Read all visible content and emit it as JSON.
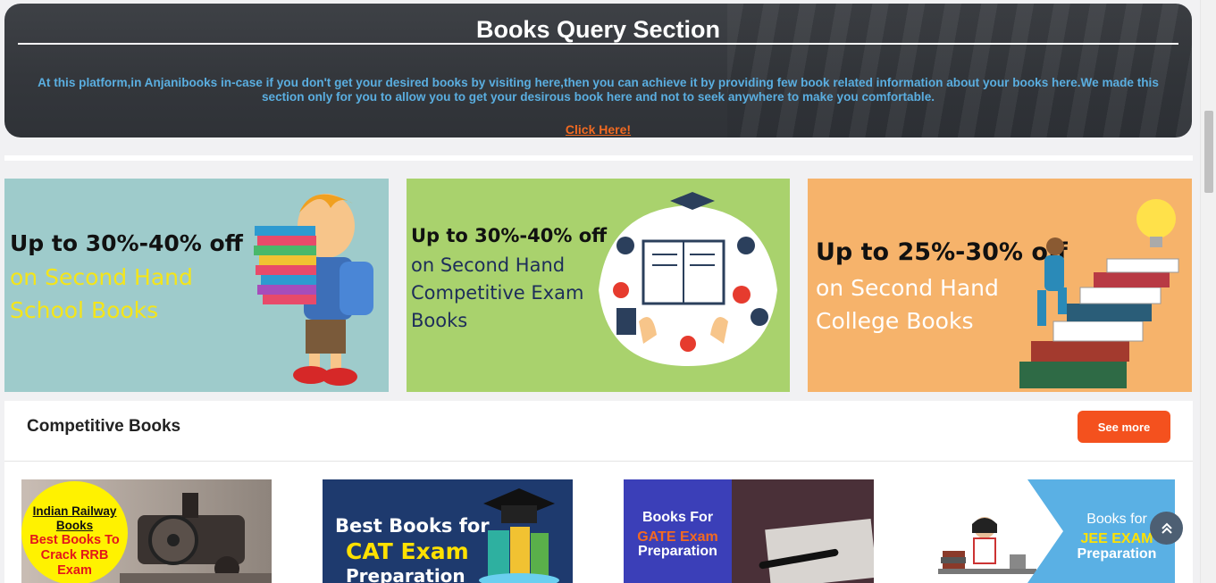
{
  "query": {
    "title": "Books Query Section",
    "description": "At this platform,in Anjanibooks in-case if you don't get your desired books by visiting here,then you can achieve it by providing few book related information about your books here.We made this section only for you to allow you to get your desirous book here and not to seek anywhere to make you comfortable.",
    "link": "Click Here!"
  },
  "promos": [
    {
      "headline": "Up to 30%-40% off",
      "subline": "on Second Hand School Books"
    },
    {
      "headline": "Up to 30%-40% off",
      "subline": "on Second Hand Competitive Exam Books"
    },
    {
      "headline": "Up to 25%-30% off",
      "subline": "on Second Hand College Books"
    }
  ],
  "section": {
    "title": "Competitive Books",
    "see_more": "See more"
  },
  "books": {
    "railway": {
      "line1": "Indian Railway",
      "line2": "Books",
      "line3": "Best Books To",
      "line4": "Crack RRB",
      "line5": "Exam"
    },
    "cat": {
      "line1": "Best Books for",
      "line2": "CAT Exam",
      "line3": "Preparation"
    },
    "gate": {
      "line1": "Books For",
      "line2": "GATE Exam",
      "line3": "Preparation"
    },
    "jee": {
      "line1": "Books for",
      "line2": "JEE EXAM",
      "line3": "Preparation"
    }
  },
  "colors": {
    "accent": "#f4511e",
    "link": "#f26a21",
    "query_text": "#5aaee0"
  }
}
